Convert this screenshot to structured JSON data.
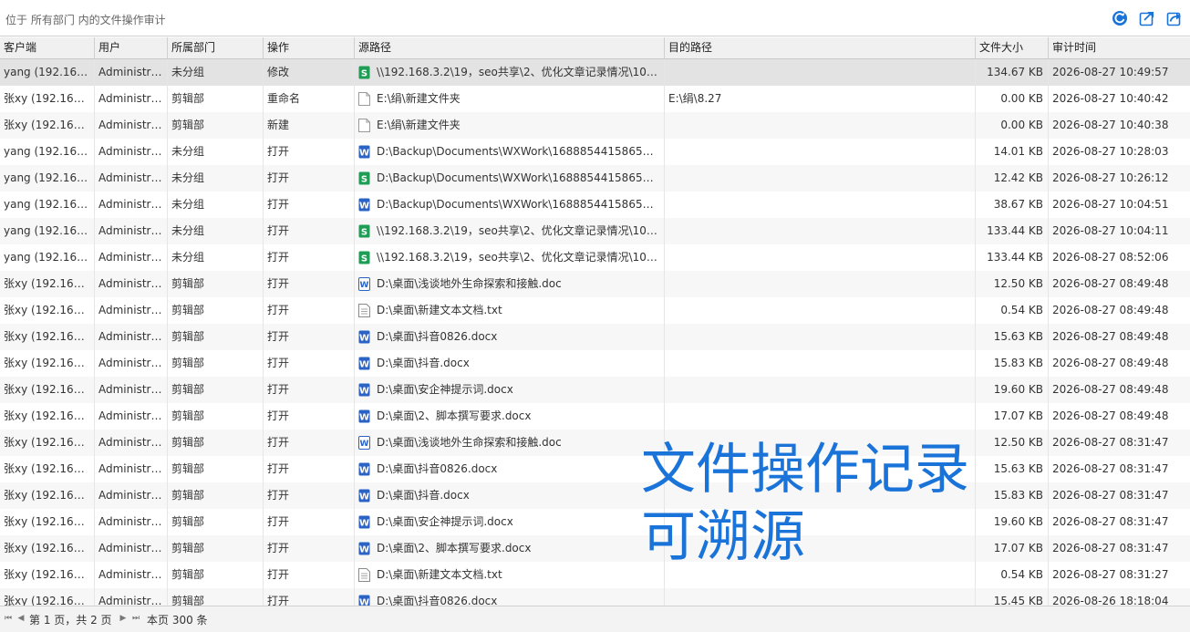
{
  "header": {
    "breadcrumb": "位于 所有部门 内的文件操作审计"
  },
  "toolbar": {
    "icons": [
      "refresh-icon",
      "export-icon",
      "share-icon"
    ],
    "accent": "#1a73d8"
  },
  "columns": {
    "client": "客户端",
    "user": "用户",
    "dept": "所属部门",
    "op": "操作",
    "src": "源路径",
    "dst": "目的路径",
    "size": "文件大小",
    "time": "审计时间"
  },
  "rows": [
    {
      "client": "yang (192.168.…",
      "user": "Administra…",
      "dept": "未分组",
      "op": "修改",
      "icon": "excel",
      "src": "\\\\192.168.3.2\\19，seo共享\\2、优化文章记录情况\\10、…",
      "dst": "",
      "size": "134.67 KB",
      "time": "2026-08-27 10:49:57"
    },
    {
      "client": "张xy (192.168.3…",
      "user": "Administra…",
      "dept": "剪辑部",
      "op": "重命名",
      "icon": "blank",
      "src": "E:\\绢\\新建文件夹",
      "dst": "E:\\绢\\8.27",
      "size": "0.00 KB",
      "time": "2026-08-27 10:40:42"
    },
    {
      "client": "张xy (192.168.3…",
      "user": "Administra…",
      "dept": "剪辑部",
      "op": "新建",
      "icon": "blank",
      "src": "E:\\绢\\新建文件夹",
      "dst": "",
      "size": "0.00 KB",
      "time": "2026-08-27 10:40:38"
    },
    {
      "client": "yang (192.168.…",
      "user": "Administra…",
      "dept": "未分组",
      "op": "打开",
      "icon": "word",
      "src": "D:\\Backup\\Documents\\WXWork\\168885441586582…",
      "dst": "",
      "size": "14.01 KB",
      "time": "2026-08-27 10:28:03"
    },
    {
      "client": "yang (192.168.…",
      "user": "Administra…",
      "dept": "未分组",
      "op": "打开",
      "icon": "excel",
      "src": "D:\\Backup\\Documents\\WXWork\\168885441586582…",
      "dst": "",
      "size": "12.42 KB",
      "time": "2026-08-27 10:26:12"
    },
    {
      "client": "yang (192.168.…",
      "user": "Administra…",
      "dept": "未分组",
      "op": "打开",
      "icon": "word",
      "src": "D:\\Backup\\Documents\\WXWork\\168885441586582…",
      "dst": "",
      "size": "38.67 KB",
      "time": "2026-08-27 10:04:51"
    },
    {
      "client": "yang (192.168.…",
      "user": "Administra…",
      "dept": "未分组",
      "op": "打开",
      "icon": "excel",
      "src": "\\\\192.168.3.2\\19，seo共享\\2、优化文章记录情况\\10、…",
      "dst": "",
      "size": "133.44 KB",
      "time": "2026-08-27 10:04:11"
    },
    {
      "client": "yang (192.168.…",
      "user": "Administra…",
      "dept": "未分组",
      "op": "打开",
      "icon": "excel",
      "src": "\\\\192.168.3.2\\19，seo共享\\2、优化文章记录情况\\10、…",
      "dst": "",
      "size": "133.44 KB",
      "time": "2026-08-27 08:52:06"
    },
    {
      "client": "张xy (192.168.3…",
      "user": "Administra…",
      "dept": "剪辑部",
      "op": "打开",
      "icon": "doc",
      "src": "D:\\桌面\\浅谈地外生命探索和接触.doc",
      "dst": "",
      "size": "12.50 KB",
      "time": "2026-08-27 08:49:48"
    },
    {
      "client": "张xy (192.168.3…",
      "user": "Administra…",
      "dept": "剪辑部",
      "op": "打开",
      "icon": "txt",
      "src": "D:\\桌面\\新建文本文档.txt",
      "dst": "",
      "size": "0.54 KB",
      "time": "2026-08-27 08:49:48"
    },
    {
      "client": "张xy (192.168.3…",
      "user": "Administra…",
      "dept": "剪辑部",
      "op": "打开",
      "icon": "word",
      "src": "D:\\桌面\\抖音0826.docx",
      "dst": "",
      "size": "15.63 KB",
      "time": "2026-08-27 08:49:48"
    },
    {
      "client": "张xy (192.168.3…",
      "user": "Administra…",
      "dept": "剪辑部",
      "op": "打开",
      "icon": "word",
      "src": "D:\\桌面\\抖音.docx",
      "dst": "",
      "size": "15.83 KB",
      "time": "2026-08-27 08:49:48"
    },
    {
      "client": "张xy (192.168.3…",
      "user": "Administra…",
      "dept": "剪辑部",
      "op": "打开",
      "icon": "word",
      "src": "D:\\桌面\\安企神提示词.docx",
      "dst": "",
      "size": "19.60 KB",
      "time": "2026-08-27 08:49:48"
    },
    {
      "client": "张xy (192.168.3…",
      "user": "Administra…",
      "dept": "剪辑部",
      "op": "打开",
      "icon": "word",
      "src": "D:\\桌面\\2、脚本撰写要求.docx",
      "dst": "",
      "size": "17.07 KB",
      "time": "2026-08-27 08:49:48"
    },
    {
      "client": "张xy (192.168.3…",
      "user": "Administra…",
      "dept": "剪辑部",
      "op": "打开",
      "icon": "doc",
      "src": "D:\\桌面\\浅谈地外生命探索和接触.doc",
      "dst": "",
      "size": "12.50 KB",
      "time": "2026-08-27 08:31:47"
    },
    {
      "client": "张xy (192.168.3…",
      "user": "Administra…",
      "dept": "剪辑部",
      "op": "打开",
      "icon": "word",
      "src": "D:\\桌面\\抖音0826.docx",
      "dst": "",
      "size": "15.63 KB",
      "time": "2026-08-27 08:31:47"
    },
    {
      "client": "张xy (192.168.3…",
      "user": "Administra…",
      "dept": "剪辑部",
      "op": "打开",
      "icon": "word",
      "src": "D:\\桌面\\抖音.docx",
      "dst": "",
      "size": "15.83 KB",
      "time": "2026-08-27 08:31:47"
    },
    {
      "client": "张xy (192.168.3…",
      "user": "Administra…",
      "dept": "剪辑部",
      "op": "打开",
      "icon": "word",
      "src": "D:\\桌面\\安企神提示词.docx",
      "dst": "",
      "size": "19.60 KB",
      "time": "2026-08-27 08:31:47"
    },
    {
      "client": "张xy (192.168.3…",
      "user": "Administra…",
      "dept": "剪辑部",
      "op": "打开",
      "icon": "word",
      "src": "D:\\桌面\\2、脚本撰写要求.docx",
      "dst": "",
      "size": "17.07 KB",
      "time": "2026-08-27 08:31:47"
    },
    {
      "client": "张xy (192.168.3…",
      "user": "Administra…",
      "dept": "剪辑部",
      "op": "打开",
      "icon": "txt",
      "src": "D:\\桌面\\新建文本文档.txt",
      "dst": "",
      "size": "0.54 KB",
      "time": "2026-08-27 08:31:27"
    },
    {
      "client": "张xy (192.168.3…",
      "user": "Administra…",
      "dept": "剪辑部",
      "op": "打开",
      "icon": "word",
      "src": "D:\\桌面\\抖音0826.docx",
      "dst": "",
      "size": "15.45 KB",
      "time": "2026-08-26 18:18:04"
    }
  ],
  "selected_row": 0,
  "watermark": {
    "line1": "文件操作记录",
    "line2": "可溯源",
    "color": "#1a73d8"
  },
  "pager": {
    "page_info": "第 1 页，共 2 页",
    "count_info": "本页 300 条"
  },
  "icon_colors": {
    "excel": "#1f9d55",
    "word": "#2b63c4",
    "doc": "#2b63c4",
    "txt": "#8a8a8a",
    "blank": "#9a9a9a"
  }
}
